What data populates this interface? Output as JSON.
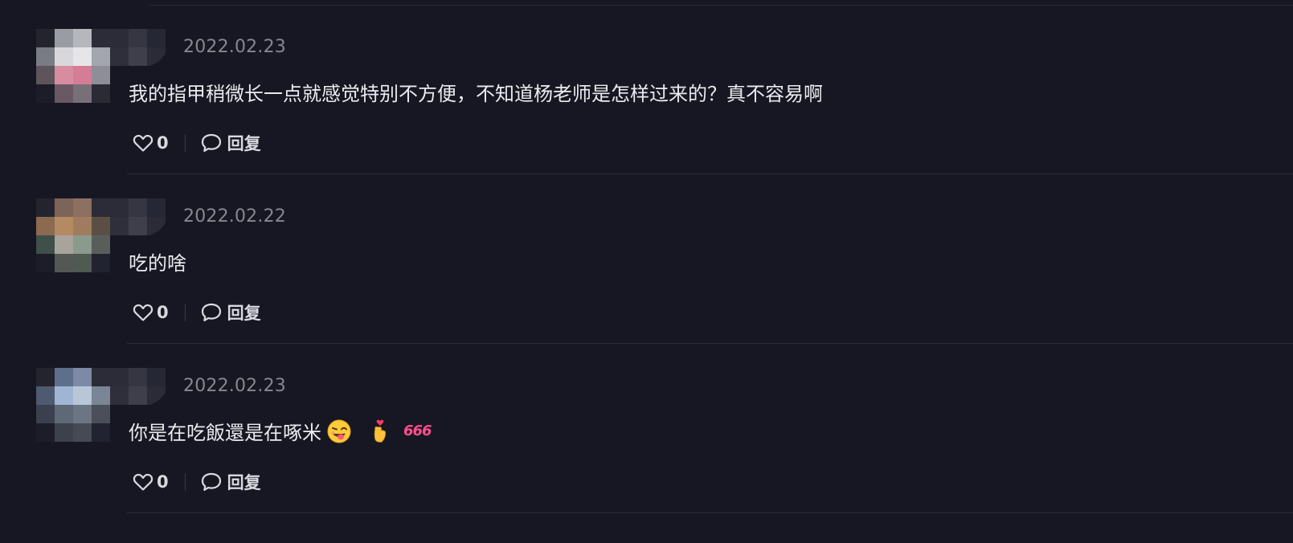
{
  "comments": [
    {
      "date": "2022.02.23",
      "text": "我的指甲稍微长一点就感觉特别不方便，不知道杨老师是怎样过来的？真不容易啊",
      "likes": "0",
      "reply_label": "回复",
      "avatar_colors": [
        "#23242e",
        "#9a9ca3",
        "#b5b7bd",
        "#2b2c37",
        "#7a7c85",
        "#d8d8dc",
        "#e6e6e9",
        "#a4a6ad",
        "#5d545c",
        "#d78ca0",
        "#d57c96",
        "#8d8e96",
        "#1c1d28",
        "#6a5865",
        "#777078",
        "#2a2b35"
      ],
      "name_colors": [
        "#2b2c37",
        "#353641",
        "#262734",
        "#2e2f3a",
        "#3e3f4a",
        "#2a2b36"
      ]
    },
    {
      "date": "2022.02.22",
      "text": "吃的啥",
      "likes": "0",
      "reply_label": "回复",
      "avatar_colors": [
        "#23242e",
        "#7d6458",
        "#8c7060",
        "#2b2c37",
        "#8b6a50",
        "#b48a63",
        "#a07c5e",
        "#5b4f45",
        "#3f4f4a",
        "#a8a49c",
        "#8a9a8c",
        "#5a5e5a",
        "#1c1d28",
        "#545854",
        "#4e5a52",
        "#222330"
      ],
      "name_colors": [
        "#2b2c37",
        "#353641",
        "#262734",
        "#2e2f3a",
        "#3e3f4a",
        "#2a2b36"
      ]
    },
    {
      "date": "2022.02.23",
      "text": "你是在吃飯還是在啄米",
      "likes": "0",
      "reply_label": "回复",
      "emoji_badge": "666",
      "avatar_colors": [
        "#23242e",
        "#5e6f8c",
        "#7d8aa5",
        "#2b2c37",
        "#4e5a70",
        "#9fb5d3",
        "#b8c6d8",
        "#7a8596",
        "#3a404e",
        "#5f6876",
        "#6c7584",
        "#4a4f5a",
        "#1c1d28",
        "#3c414c",
        "#454a55",
        "#222330"
      ],
      "name_colors": [
        "#2b2c37",
        "#353641",
        "#262734",
        "#2e2f3a",
        "#3e3f4a",
        "#2a2b36"
      ]
    }
  ],
  "colors": {
    "background": "#161722",
    "date": "#86878f",
    "text": "#eaeaef",
    "divider": "#2a2b35",
    "badge": "#ff4d8d"
  },
  "icons": {
    "like": "heart-outline-icon",
    "reply": "chat-bubble-icon"
  }
}
